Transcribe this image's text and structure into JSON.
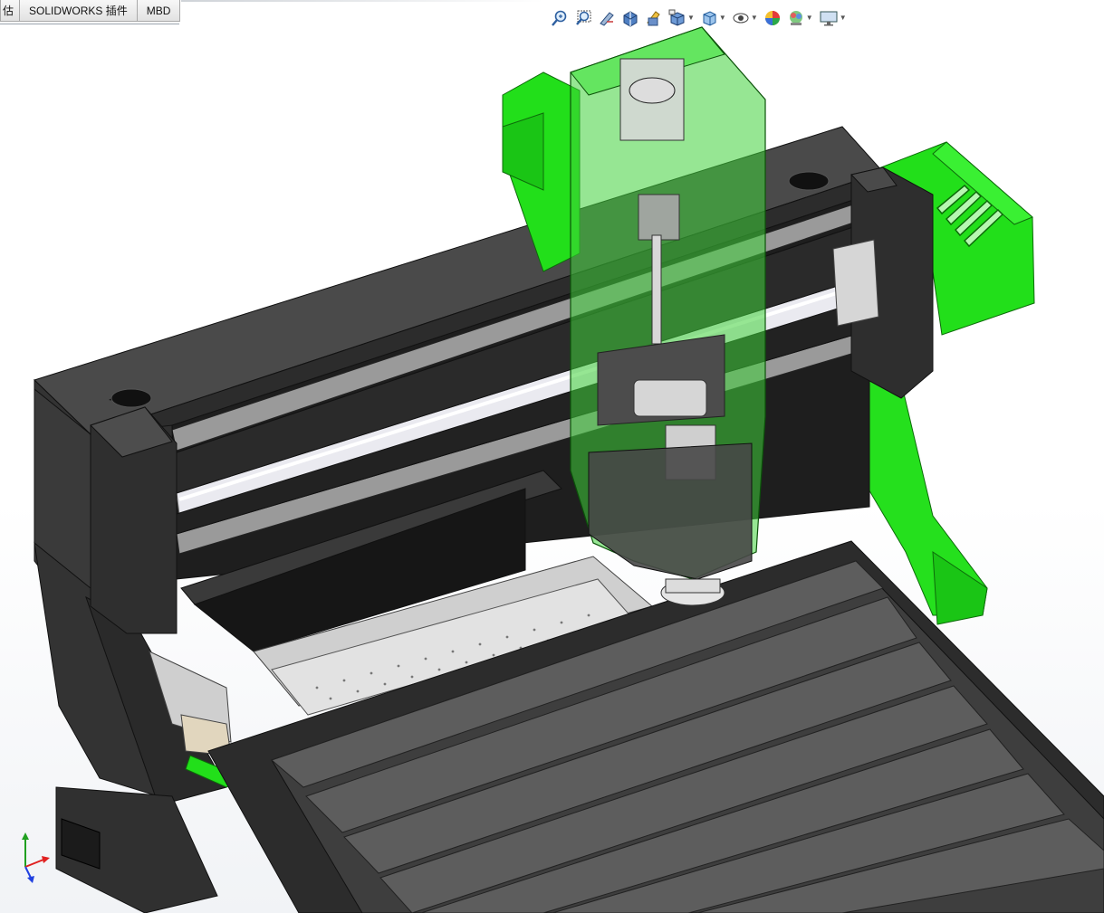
{
  "tabs": [
    {
      "label": "估"
    },
    {
      "label": "SOLIDWORKS 插件"
    },
    {
      "label": "MBD"
    }
  ],
  "heads_up_toolbar": {
    "icons": [
      "zoom-to-fit-icon",
      "zoom-to-area-icon",
      "previous-view-icon",
      "section-view-icon",
      "dynamic-annotation-views-icon",
      "view-orientation-icon",
      "display-style-icon",
      "hide-show-items-icon",
      "edit-appearance-icon",
      "apply-scene-icon",
      "view-settings-icon"
    ]
  },
  "viewport": {
    "model": "cnc-router-machine-assembly",
    "colors": {
      "frame": "#3d3d3d",
      "frame_dark": "#2a2a2a",
      "green_parts": "#22e019",
      "green_transparent": "#3fd13a",
      "table": "#5a5a5a",
      "background_top": "#ffffff",
      "background_bottom": "#eef0f3"
    }
  },
  "triad": {
    "axes": [
      {
        "axis": "x",
        "color": "#e02020"
      },
      {
        "axis": "y",
        "color": "#20a020"
      },
      {
        "axis": "z",
        "color": "#2040e0"
      }
    ]
  }
}
